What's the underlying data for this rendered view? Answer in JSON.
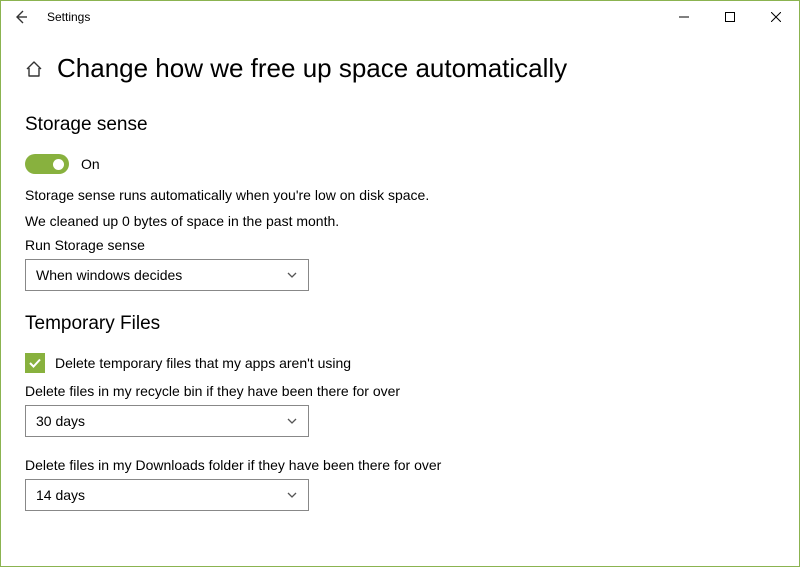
{
  "window": {
    "app_title": "Settings"
  },
  "header": {
    "title": "Change how we free up space automatically"
  },
  "storage_sense": {
    "heading": "Storage sense",
    "toggle_state_label": "On",
    "desc_line1": "Storage sense runs automatically when you're low on disk space.",
    "desc_line2": "We cleaned up 0 bytes of space in the past month.",
    "run_label": "Run Storage sense",
    "run_value": "When windows decides"
  },
  "temporary_files": {
    "heading": "Temporary Files",
    "delete_temp_label": "Delete temporary files that my apps aren't using",
    "recycle_label": "Delete files in my recycle bin if they have been there for over",
    "recycle_value": "30 days",
    "downloads_label": "Delete files in my Downloads folder if they have been there for over",
    "downloads_value": "14 days"
  }
}
